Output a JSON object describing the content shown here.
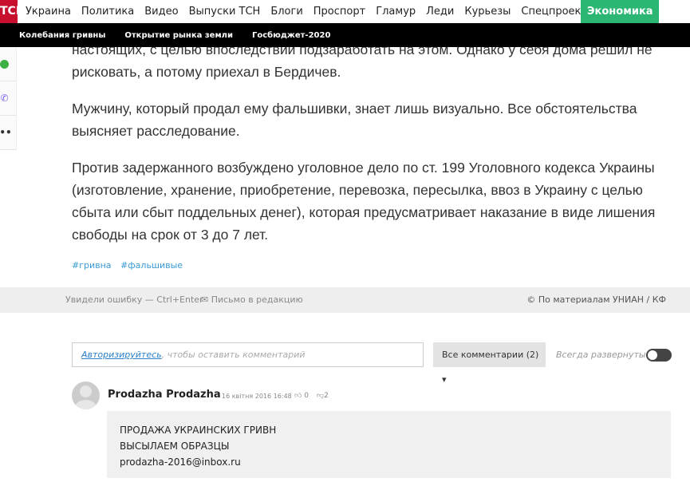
{
  "nav": {
    "logo": "ТСН",
    "items": [
      "Украина",
      "Политика",
      "Видео",
      "Выпуски ТСН",
      "Блоги",
      "Проспорт",
      "Гламур",
      "Леди",
      "Курьезы",
      "Спецпроекты"
    ],
    "active": "Экономика ≡"
  },
  "subnav": [
    "Колебания гривны",
    "Открытие рынка земли",
    "Госбюджет-2020"
  ],
  "share_icons": [
    "whatsapp-icon",
    "viber-icon",
    "more-icon"
  ],
  "article": {
    "paragraphs": [
      "настоящих, с целью впоследствии подзаработать на этом. Однако у себя дома решил не рисковать, а потому приехал в Бердичев.",
      "Мужчину, который продал ему фальшивки, знает лишь визуально. Все обстоятельства выясняет расследование.",
      "Против задержанного возбуждено уголовное дело по ст. 199 Уголовного кодекса Украины (изготовление, хранение, приобретение, перевозка, пересылка, ввоз в Украину с целью сбыта или сбыт поддельных денег), которая предусматривает наказание в виде лишения свободы на срок от 3 до 7 лет."
    ],
    "tags": [
      "#гривна",
      "#фальшивые"
    ]
  },
  "footer_bar": {
    "error": "Увидели ошибку — Ctrl+Enter",
    "letter": "✉ Письмо в редакцию",
    "source": "© По материалам УНИАН / КФ"
  },
  "comments": {
    "login_link": "Авторизируйтесь",
    "login_rest": ", чтобы оставить комментарий",
    "all": "Все комментарии (2) ▾",
    "always": "Всегда развернутые",
    "items": [
      {
        "author": "Prodazha Prodazha",
        "date": "16 квітня 2016 16:48",
        "likes": "0",
        "dislikes": "2",
        "lines": [
          "ПРОДАЖА УКРАИНСКИХ ГРИВН",
          "ВЫСЫЛАЕМ ОБРАЗЦЫ",
          "prodazha-2016@inbox.ru"
        ]
      }
    ]
  }
}
